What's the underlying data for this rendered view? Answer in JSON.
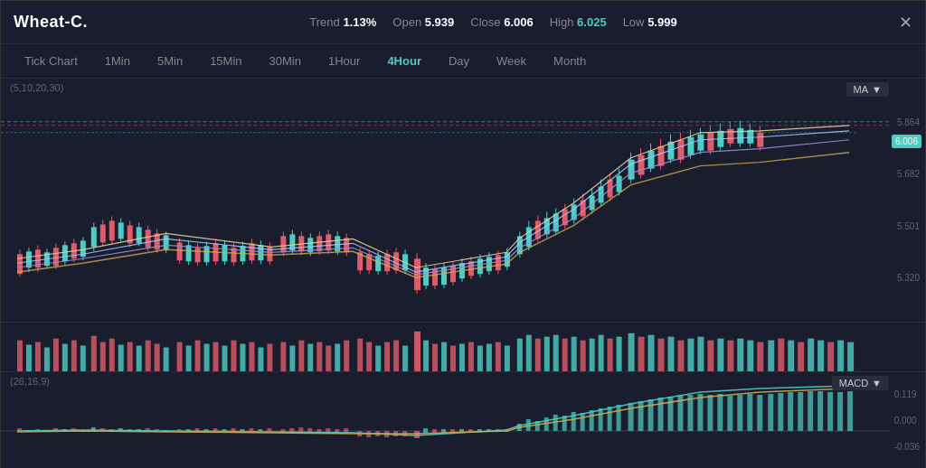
{
  "header": {
    "title": "Wheat-C.",
    "trend_label": "Trend",
    "trend_value": "1.13%",
    "open_label": "Open",
    "open_value": "5.939",
    "close_label": "Close",
    "close_value": "6.006",
    "high_label": "High",
    "high_value": "6.025",
    "low_label": "Low",
    "low_value": "5.999",
    "close_icon": "✕"
  },
  "tabs": [
    {
      "label": "Tick Chart",
      "active": false
    },
    {
      "label": "1Min",
      "active": false
    },
    {
      "label": "5Min",
      "active": false
    },
    {
      "label": "15Min",
      "active": false
    },
    {
      "label": "30Min",
      "active": false
    },
    {
      "label": "1Hour",
      "active": false
    },
    {
      "label": "4Hour",
      "active": true
    },
    {
      "label": "Day",
      "active": false
    },
    {
      "label": "Week",
      "active": false
    },
    {
      "label": "Month",
      "active": false
    }
  ],
  "main_chart": {
    "indicator_label": "(5,10,20,30)",
    "ma_badge": "MA",
    "price_badge": "6.006",
    "price_levels": [
      "5.864",
      "5.682",
      "5.501",
      "5.320"
    ]
  },
  "macd_chart": {
    "indicator_label": "(26,16,9)",
    "macd_badge": "MACD",
    "price_levels": [
      "0.119",
      "0.000",
      "-0.036"
    ]
  },
  "colors": {
    "accent_cyan": "#4ecdc4",
    "bull": "#4ecdc4",
    "bear": "#e05c6a",
    "ma5": "#e8d5a3",
    "ma10": "#a0c4ff",
    "ma20": "#9b8fd4",
    "ma30": "#e8d5a3",
    "volume_bear": "#e05c6a",
    "macd_line": "#4ecdc4",
    "signal_line": "#e8d5a3",
    "hist_bull": "#4ecdc4",
    "hist_bear": "#e05c6a",
    "grid": "#252836",
    "dashed_line": "#4ecdc4",
    "pink_dashed": "#e05c6a"
  }
}
